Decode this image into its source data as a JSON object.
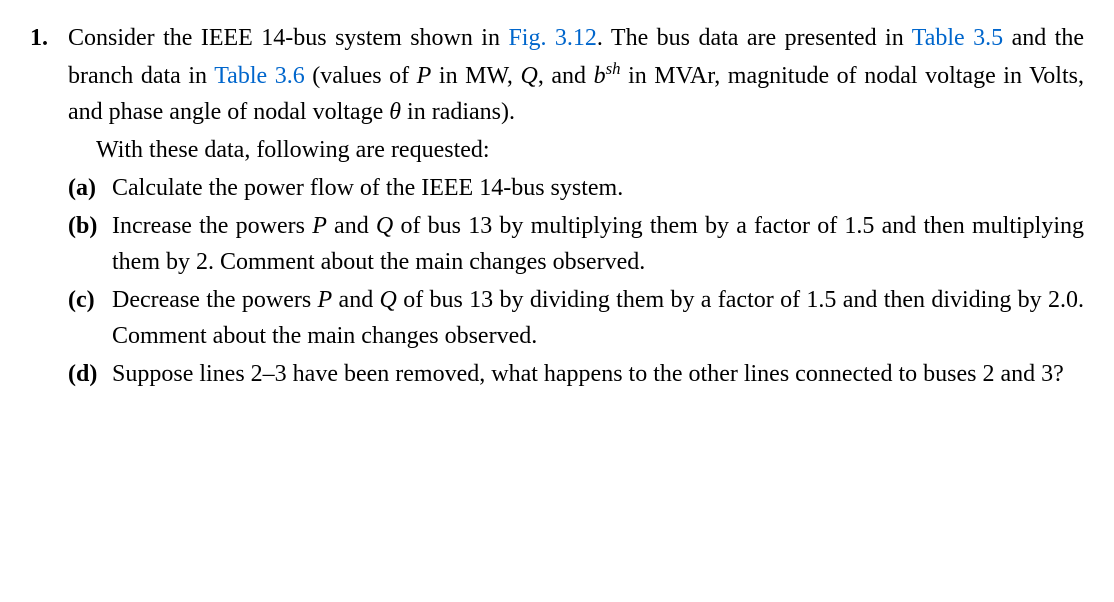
{
  "problem_number": "1.",
  "intro_segments": {
    "s1": "Consider the IEEE 14-bus system shown in ",
    "link1": "Fig. 3.12",
    "s2": ". The bus data are presented in ",
    "link2": "Table 3.5",
    "s3": " and the branch data in ",
    "link3": "Table 3.6",
    "s4": " (values of ",
    "var_P": "P",
    "s5": " in MW, ",
    "var_Q": "Q",
    "s6": ", and ",
    "var_b": "b",
    "var_b_sup": "sh",
    "s7": " in MVAr, magnitude of nodal voltage in Volts, and phase angle of nodal voltage ",
    "var_theta": "θ",
    "s8": " in radians)."
  },
  "followup": "With these data, following are requested:",
  "parts": {
    "a": {
      "label": "(a)",
      "text": "Calculate the power flow of the IEEE 14-bus system."
    },
    "b": {
      "label": "(b)",
      "s1": "Increase the powers ",
      "var_P": "P",
      "s2": " and ",
      "var_Q": "Q",
      "s3": " of bus 13 by multiplying them by a factor of 1.5 and then multiplying them by 2. Comment about the main changes observed."
    },
    "c": {
      "label": "(c)",
      "s1": "Decrease the powers ",
      "var_P": "P",
      "s2": " and ",
      "var_Q": "Q",
      "s3": " of bus 13 by dividing them by a factor of 1.5 and then dividing by 2.0. Comment about the main changes observed."
    },
    "d": {
      "label": "(d)",
      "text": "Suppose lines 2–3 have been removed, what happens to the other lines connected to buses 2 and 3?"
    }
  }
}
